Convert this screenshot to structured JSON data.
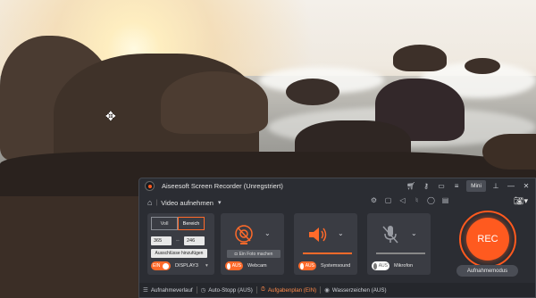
{
  "window": {
    "title": "Aiseesoft Screen Recorder (Unregstriert)",
    "mini_label": "Mini"
  },
  "toolbar": {
    "mode_label": "Video aufnehmen"
  },
  "region": {
    "full_label": "Voll",
    "area_label": "Bereich",
    "width": "365",
    "height": "246",
    "exclude_label": "Ausschlüsse hinzufügen",
    "toggle_state": "EIN",
    "display_label": "DISPLAY3"
  },
  "webcam": {
    "photo_label": "Ein Foto machen",
    "toggle_state": "AUS",
    "label": "Webcam"
  },
  "system_sound": {
    "toggle_state": "AUS",
    "label": "Systemsound"
  },
  "microphone": {
    "toggle_state": "AUS",
    "label": "Mikrofon"
  },
  "record": {
    "button_label": "REC",
    "mode_label": "Aufnahmemodus"
  },
  "statusbar": {
    "history": "Aufnahmeverlauf",
    "autostop": "Auto-Stopp (AUS)",
    "schedule": "Aufgabenplan (EIN)",
    "watermark": "Wasserzeichen (AUS)"
  },
  "colors": {
    "accent": "#ff5a1f",
    "window_bg": "#2b2d33",
    "panel_bg": "#3a3c43"
  }
}
